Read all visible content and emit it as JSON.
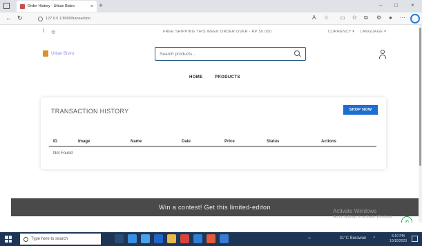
{
  "browser": {
    "tab_title": "Order History - Urban Bistro",
    "tab_close": "×",
    "new_tab": "+",
    "url": "127.0.0.1:8000/transaction",
    "controls": {
      "minimize": "–",
      "maximize": "□",
      "close": "×"
    }
  },
  "topbar": {
    "shipping_text": "FREE SHIPPING THIS WEEK ORDER OVER - RP 50.000",
    "currency": "CURRENCY ▾",
    "language": "LANGUAGE ▾"
  },
  "header": {
    "logo_text": "Urban Bistro",
    "search_placeholder": "Search products..."
  },
  "menu": {
    "home": "HOME",
    "products": "PRODUCTS"
  },
  "card": {
    "title": "TRANSACTION HISTORY",
    "shop_button": "SHOP NOW",
    "columns": [
      "ID",
      "Image",
      "Name",
      "Date",
      "Price",
      "Status",
      "Actions"
    ],
    "empty_text": "Not Found"
  },
  "banner": {
    "text": "Win a contest! Get this limited-editon"
  },
  "watermark": {
    "title": "Activate Windows",
    "subtitle": "Go to Settings to activate Windows."
  },
  "taskbar": {
    "search_placeholder": "Type here to search",
    "weather": "31°C Berawan",
    "time": "5:10 PM",
    "date": "10/10/2023"
  },
  "colors": {
    "accent": "#1c6ed1",
    "banner": "#4a4a4a",
    "taskbar": "#1e3556"
  }
}
